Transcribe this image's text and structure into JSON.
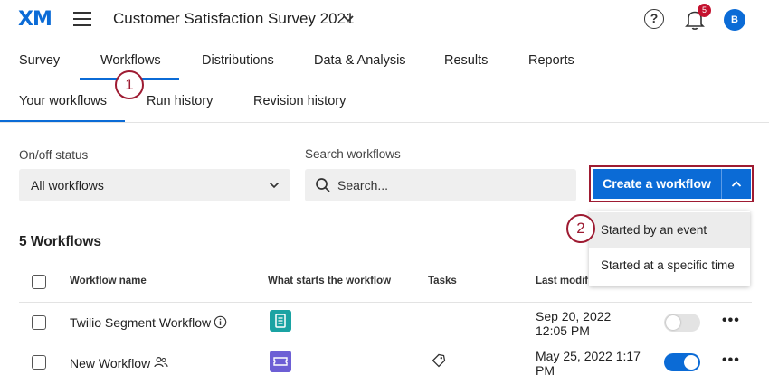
{
  "header": {
    "logo": "XM",
    "project_title": "Customer Satisfaction Survey 2021",
    "notification_count": "5",
    "avatar_initial": "B",
    "help_glyph": "?"
  },
  "main_tabs": [
    {
      "label": "Survey"
    },
    {
      "label": "Workflows",
      "active": true
    },
    {
      "label": "Distributions"
    },
    {
      "label": "Data & Analysis"
    },
    {
      "label": "Results"
    },
    {
      "label": "Reports"
    }
  ],
  "sub_tabs": [
    {
      "label": "Your workflows",
      "active": true
    },
    {
      "label": "Run history"
    },
    {
      "label": "Revision history"
    }
  ],
  "callouts": [
    "1",
    "2"
  ],
  "filters": {
    "status_label": "On/off status",
    "status_value": "All workflows",
    "search_label": "Search workflows",
    "search_placeholder": "Search..."
  },
  "create_button": {
    "label": "Create a workflow",
    "menu_items": [
      "Started by an event",
      "Started at a specific time"
    ]
  },
  "workflow_count": "5 Workflows",
  "table": {
    "columns": [
      "Workflow name",
      "What starts the workflow",
      "Tasks",
      "Last modif"
    ],
    "rows": [
      {
        "name": "Twilio Segment Workflow",
        "date_line1": "Sep 20, 2022",
        "date_line2": "12:05 PM",
        "enabled": false
      },
      {
        "name": "New Workflow",
        "date_line1": "May 25, 2022 1:17",
        "date_line2": "PM",
        "enabled": true
      }
    ]
  },
  "colors": {
    "accent": "#0b6bd6",
    "callout": "#9e1b32",
    "trigger_teal": "#1aa3a3",
    "trigger_purple": "#6d5fd5"
  }
}
